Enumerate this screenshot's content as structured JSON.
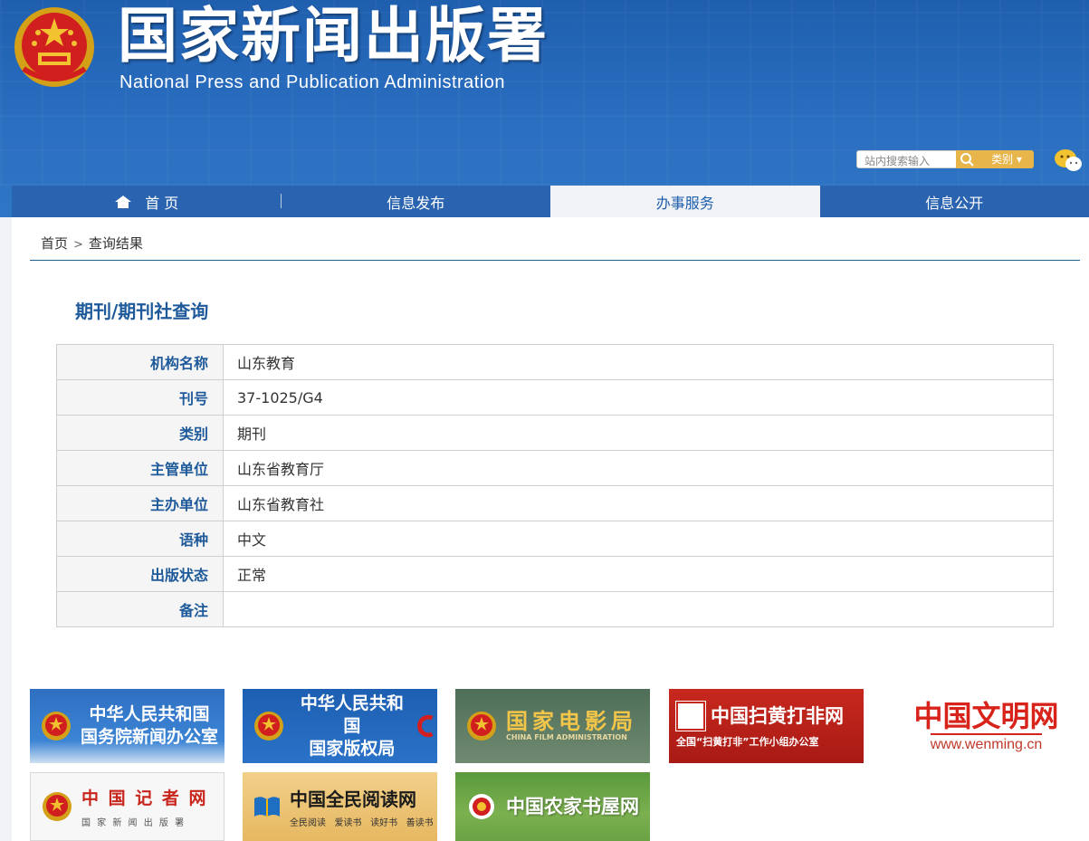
{
  "header": {
    "title": "国家新闻出版署",
    "subtitle": "National  Press and Publication Administration",
    "search_placeholder": "站内搜索输入",
    "category_label": "类别 ▾",
    "icons": [
      "national-emblem-icon",
      "search-icon",
      "wechat-icon"
    ]
  },
  "nav": {
    "items": [
      {
        "label": "首 页",
        "icon": "home-icon"
      },
      {
        "label": "信息发布"
      },
      {
        "label": "办事服务",
        "active": true
      },
      {
        "label": "信息公开"
      }
    ]
  },
  "breadcrumb": {
    "home": "首页",
    "separator": ">",
    "current": "查询结果"
  },
  "section_title": "期刊/期刊社查询",
  "record": [
    {
      "label": "机构名称",
      "value": "山东教育"
    },
    {
      "label": "刊号",
      "value": "37-1025/G4"
    },
    {
      "label": "类别",
      "value": "期刊"
    },
    {
      "label": "主管单位",
      "value": "山东省教育厅"
    },
    {
      "label": "主办单位",
      "value": "山东省教育社"
    },
    {
      "label": "语种",
      "value": "中文"
    },
    {
      "label": "出版状态",
      "value": "正常"
    },
    {
      "label": "备注",
      "value": ""
    }
  ],
  "links": [
    {
      "line1": "中华人民共和国",
      "line2": "国务院新闻办公室"
    },
    {
      "line1": "中华人民共和国",
      "line2": "国家版权局"
    },
    {
      "line1": "国家电影局",
      "line2": "CHINA FILM ADMINISTRATION"
    },
    {
      "line1": "中国扫黄打非网",
      "line2": "全国“扫黄打非”工作小组办公室"
    },
    {
      "line1": "中国文明网",
      "line2": "www.wenming.cn"
    },
    {
      "line1": "中 国 记 者 网",
      "line2": "国 家 新 闻 出 版 署"
    },
    {
      "line1": "中国全民阅读网",
      "line2": "全民阅读   爱读书   读好书   善读书"
    },
    {
      "line1": "中国农家书屋网",
      "line2": ""
    }
  ],
  "colors": {
    "header_blue": "#2a64b0",
    "title_blue": "#1e5a9a",
    "accent_gold": "#e8b54a"
  }
}
